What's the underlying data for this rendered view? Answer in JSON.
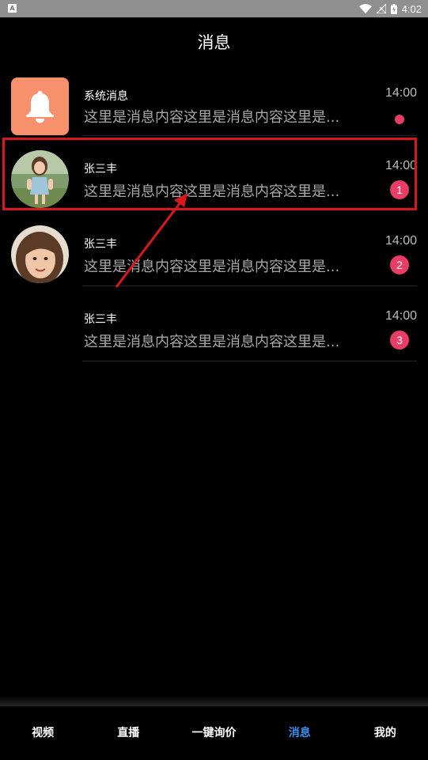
{
  "status_bar": {
    "app_icon_letter": "A",
    "time": "4:02"
  },
  "header": {
    "title": "消息"
  },
  "messages": [
    {
      "name": "系统消息",
      "preview": "这里是消息内容这里是消息内容这里是...",
      "time": "14:00",
      "badge": "",
      "avatar_icon": "bell-icon"
    },
    {
      "name": "张三丰",
      "preview": "这里是消息内容这里是消息内容这里是...",
      "time": "14:00",
      "badge": "1",
      "avatar_icon": "girl-photo"
    },
    {
      "name": "张三丰",
      "preview": "这里是消息内容这里是消息内容这里是...",
      "time": "14:00",
      "badge": "2",
      "avatar_icon": "girl-photo"
    },
    {
      "name": "张三丰",
      "preview": "这里是消息内容这里是消息内容这里是...",
      "time": "14:00",
      "badge": "3",
      "avatar_icon": ""
    }
  ],
  "bottom_nav": {
    "items": [
      {
        "label": "视频"
      },
      {
        "label": "直播"
      },
      {
        "label": "一键询价"
      },
      {
        "label": "消息"
      },
      {
        "label": "我的"
      }
    ],
    "active_color": "#3c8ef0"
  },
  "colors": {
    "badge": "#e83e66",
    "highlight": "#d9171e",
    "bell_bg": "#f7906c"
  }
}
